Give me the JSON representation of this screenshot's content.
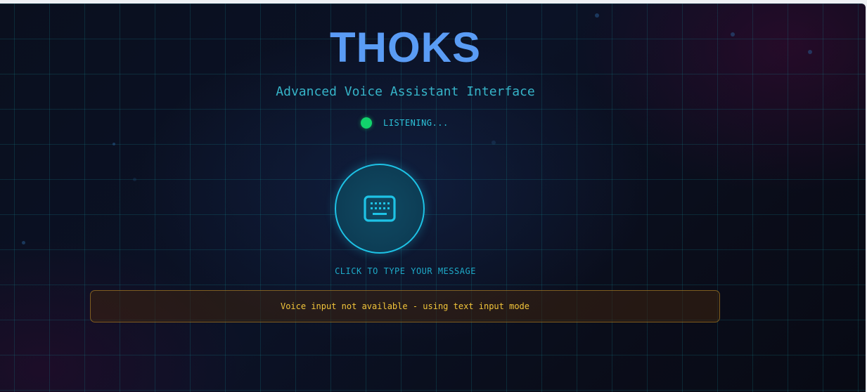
{
  "header": {
    "title": "THOKS",
    "subtitle": "Advanced Voice Assistant Interface"
  },
  "status": {
    "label": "LISTENING...",
    "indicator_color": "#12d36c"
  },
  "input_button": {
    "icon": "keyboard-icon",
    "hint": "CLICK TO TYPE YOUR MESSAGE"
  },
  "notice": {
    "message": "Voice input not available - using text input mode"
  },
  "colors": {
    "accent": "#1ec3e6",
    "title": "#5a9cf5",
    "warning": "#f2c53a"
  }
}
